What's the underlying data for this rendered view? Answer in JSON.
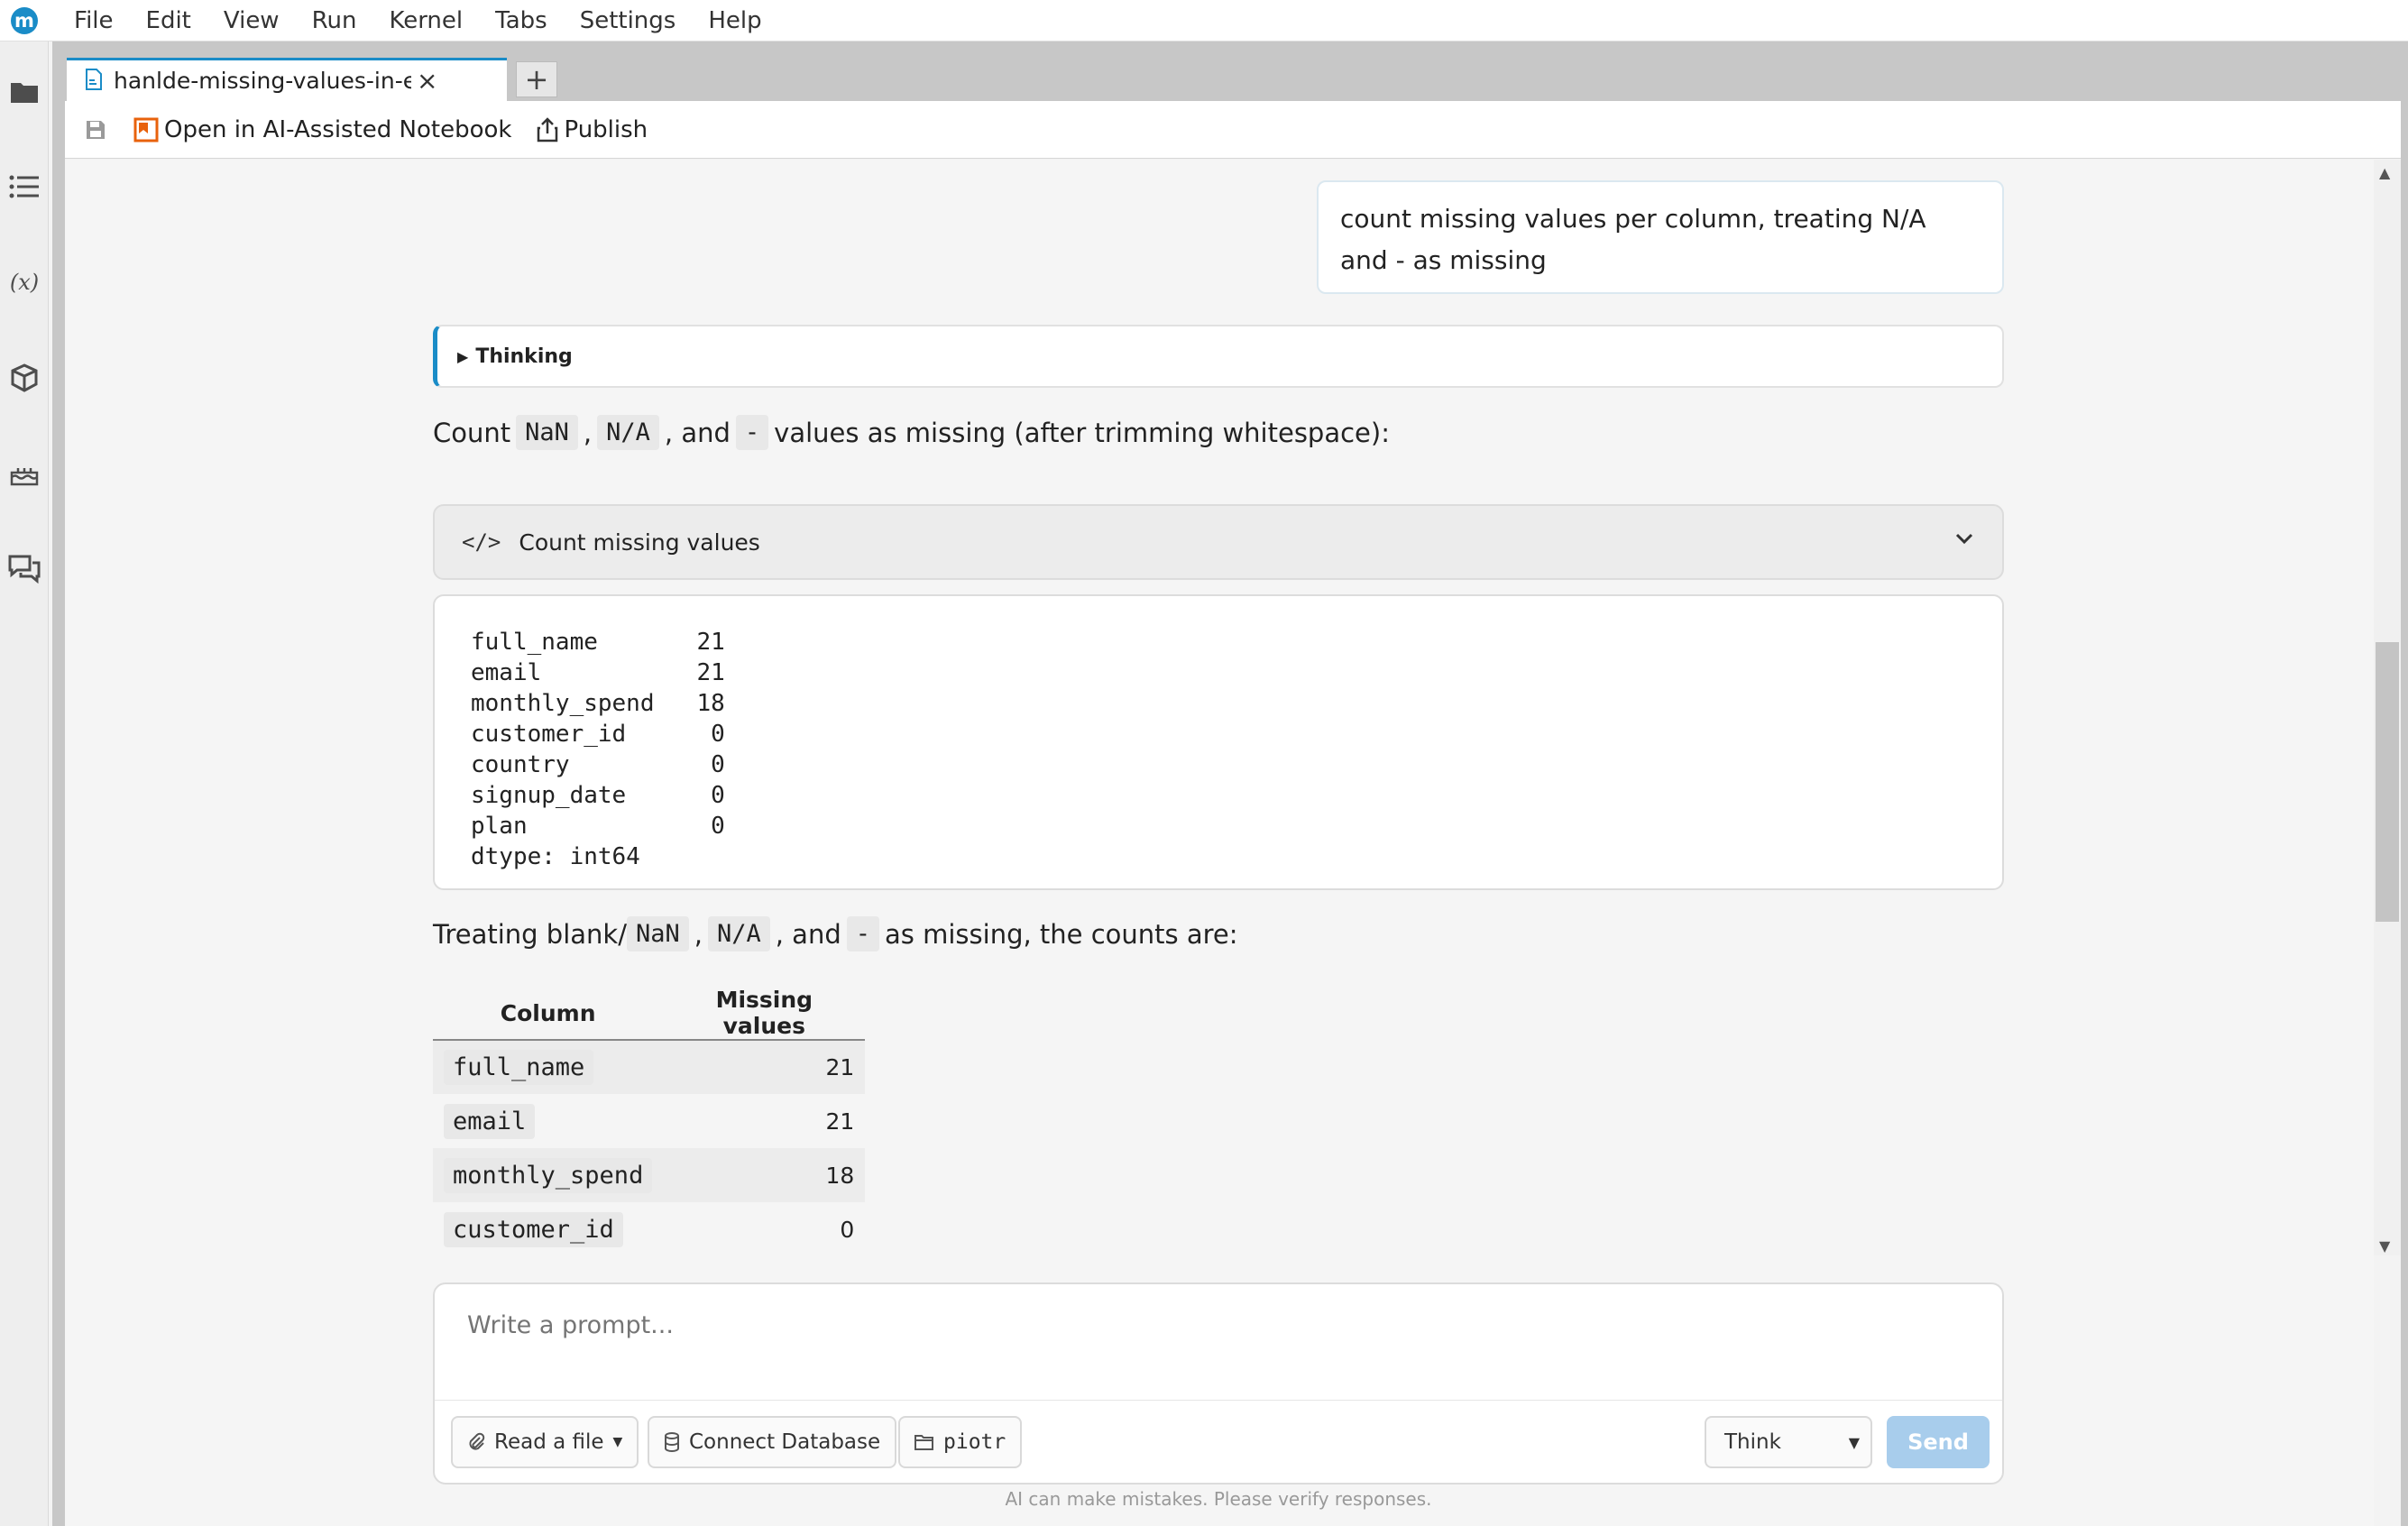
{
  "menubar": {
    "logo": "m",
    "items": [
      "File",
      "Edit",
      "View",
      "Run",
      "Kernel",
      "Tabs",
      "Settings",
      "Help"
    ]
  },
  "leftrail": {
    "icons": [
      "folder-icon",
      "list-icon",
      "variables-icon",
      "package-icon",
      "cake-icon",
      "chat-icon"
    ],
    "variables_glyph": "(x)"
  },
  "tab": {
    "label": "hanlde-missing-values-in-excel",
    "close": "×",
    "add": "+"
  },
  "toolbar": {
    "open_ai_label": "Open in AI-Assisted Notebook",
    "publish_label": "Publish"
  },
  "chat": {
    "user_message": "count missing values per column, treating N/A and - as missing",
    "thinking_label": "Thinking",
    "intro": {
      "pre": "Count",
      "chip1": "NaN",
      "sep1": ",",
      "chip2": "N/A",
      "sep2": ", and",
      "chip3": "-",
      "post": "values as missing (after trimming whitespace):"
    },
    "code_cell_label": "Count missing values",
    "code_icon": "</>",
    "output_lines": [
      "full_name       21",
      "email           21",
      "monthly_spend   18",
      "customer_id      0",
      "country          0",
      "signup_date      0",
      "plan             0",
      "dtype: int64"
    ],
    "summary": {
      "pre": "Treating blank/",
      "chip1": "NaN",
      "sep1": ",",
      "chip2": "N/A",
      "sep2": ", and",
      "chip3": "-",
      "post": "as missing, the counts are:"
    },
    "table": {
      "headers": [
        "Column",
        "Missing values"
      ],
      "rows": [
        {
          "column": "full_name",
          "value": "21"
        },
        {
          "column": "email",
          "value": "21"
        },
        {
          "column": "monthly_spend",
          "value": "18"
        },
        {
          "column": "customer_id",
          "value": "0"
        }
      ]
    }
  },
  "prompt": {
    "placeholder": "Write a prompt...",
    "read_file_label": "Read a file",
    "connect_db_label": "Connect Database",
    "folder_label": "piotr",
    "mode_label": "Think",
    "send_label": "Send",
    "disclaimer": "AI can make mistakes. Please verify responses."
  },
  "colors": {
    "accent": "#1a8cc7",
    "send_disabled": "#a8cdec",
    "ai_notebook_icon": "#e8620c"
  }
}
